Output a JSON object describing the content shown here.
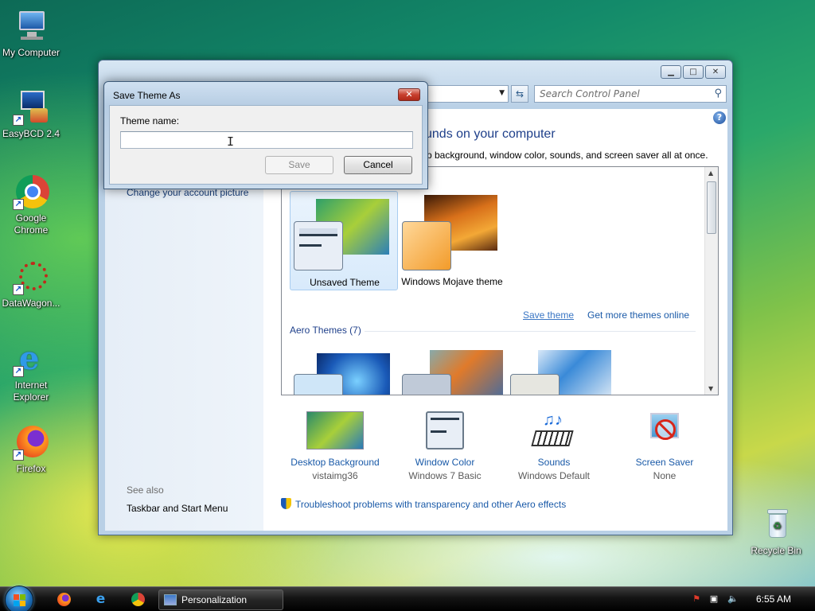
{
  "desktop": {
    "icons": [
      {
        "label": "My Computer"
      },
      {
        "label": "EasyBCD 2.4"
      },
      {
        "label": "Google Chrome"
      },
      {
        "label": "DataWagon..."
      },
      {
        "label": "Internet Explorer"
      },
      {
        "label": "Firefox"
      },
      {
        "label": "Recycle Bin"
      }
    ]
  },
  "window": {
    "search_placeholder": "Search Control Panel",
    "heading": "unds on your computer",
    "description": "p background, window color, sounds, and screen saver all at once.",
    "nav": {
      "account_link": "Change your account picture",
      "see_also": "See also",
      "taskbar_link": "Taskbar and Start Menu"
    },
    "themes": {
      "my_themes": [
        {
          "label": "Unsaved Theme",
          "selected": true
        },
        {
          "label": "Windows Mojave theme",
          "selected": false
        }
      ],
      "save_theme_link": "Save theme",
      "get_more_link": "Get more themes online",
      "aero_group": "Aero Themes (7)"
    },
    "settings": [
      {
        "name": "Desktop Background",
        "value": "vistaimg36",
        "icon": "desktop-background-icon"
      },
      {
        "name": "Window Color",
        "value": "Windows 7 Basic",
        "icon": "window-color-icon"
      },
      {
        "name": "Sounds",
        "value": "Windows Default",
        "icon": "sounds-icon"
      },
      {
        "name": "Screen Saver",
        "value": "None",
        "icon": "screen-saver-icon"
      }
    ],
    "troubleshoot_link": "Troubleshoot problems with transparency and other Aero effects"
  },
  "dialog": {
    "title": "Save Theme As",
    "field_label": "Theme name:",
    "field_value": "",
    "save_label": "Save",
    "cancel_label": "Cancel",
    "save_enabled": false
  },
  "taskbar": {
    "active_task": "Personalization",
    "clock": "6:55 AM"
  }
}
